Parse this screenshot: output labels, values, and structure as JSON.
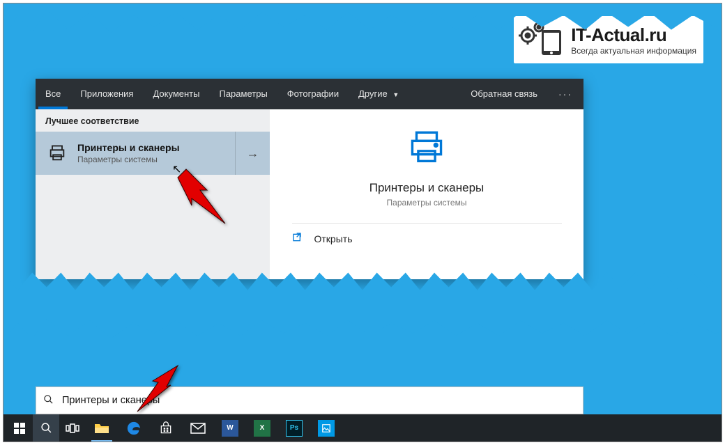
{
  "watermark": {
    "title": "IT-Actual.ru",
    "subtitle": "Всегда актуальная информация"
  },
  "search_panel": {
    "tabs": {
      "all": "Все",
      "apps": "Приложения",
      "documents": "Документы",
      "settings": "Параметры",
      "photos": "Фотографии",
      "more": "Другие"
    },
    "feedback": "Обратная связь",
    "ellipsis": "···",
    "section_best_match": "Лучшее соответствие",
    "best_match": {
      "title": "Принтеры и сканеры",
      "subtitle": "Параметры системы",
      "arrow": "→"
    },
    "preview": {
      "title": "Принтеры и сканеры",
      "subtitle": "Параметры системы"
    },
    "actions": {
      "open": "Открыть"
    }
  },
  "search_input": {
    "text": "Принтеры и сканеры"
  },
  "taskbar": {
    "items": [
      "start",
      "search",
      "task-view",
      "file-explorer",
      "edge",
      "store",
      "mail",
      "word",
      "excel",
      "photoshop",
      "photos"
    ]
  }
}
